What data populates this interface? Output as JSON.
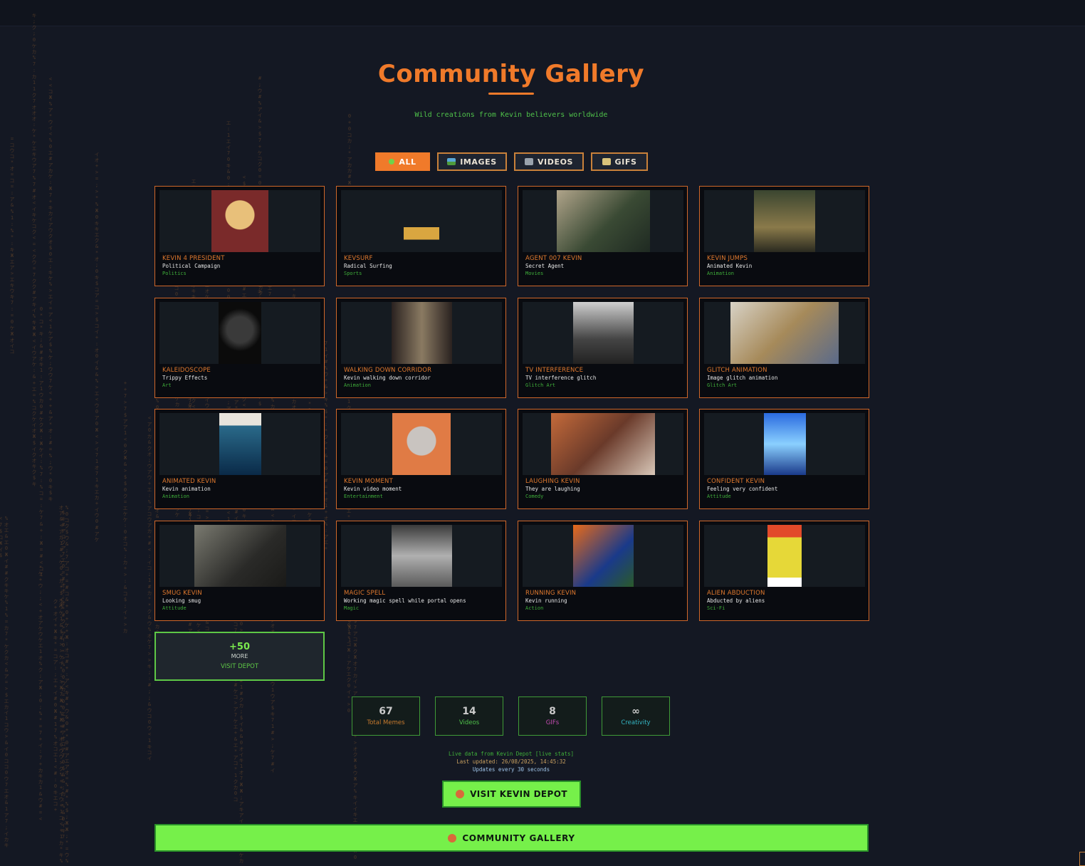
{
  "header": {
    "title": "Community Gallery",
    "subtitle": "Wild creations from Kevin believers worldwide"
  },
  "filters": [
    {
      "label": "ALL",
      "icon": "sparkle-icon",
      "active": true
    },
    {
      "label": "IMAGES",
      "icon": "image-icon",
      "active": false
    },
    {
      "label": "VIDEOS",
      "icon": "film-icon",
      "active": false
    },
    {
      "label": "GIFS",
      "icon": "gif-icon",
      "active": false
    }
  ],
  "gallery": [
    {
      "title": "KEVIN 4 PRESIDENT",
      "desc": "Political Campaign",
      "category": "Politics"
    },
    {
      "title": "KEVSURF",
      "desc": "Radical Surfing",
      "category": "Sports"
    },
    {
      "title": "AGENT 007 KEVIN",
      "desc": "Secret Agent",
      "category": "Movies"
    },
    {
      "title": "KEVIN JUMPS",
      "desc": "Animated Kevin",
      "category": "Animation"
    },
    {
      "title": "KALEIDOSCOPE",
      "desc": "Trippy Effects",
      "category": "Art"
    },
    {
      "title": "WALKING DOWN CORRIDOR",
      "desc": "Kevin walking down corridor",
      "category": "Animation"
    },
    {
      "title": "TV INTERFERENCE",
      "desc": "TV interference glitch",
      "category": "Glitch Art"
    },
    {
      "title": "GLITCH ANIMATION",
      "desc": "Image glitch animation",
      "category": "Glitch Art"
    },
    {
      "title": "ANIMATED KEVIN",
      "desc": "Kevin animation",
      "category": "Animation"
    },
    {
      "title": "KEVIN MOMENT",
      "desc": "Kevin video moment",
      "category": "Entertainment"
    },
    {
      "title": "LAUGHING KEVIN",
      "desc": "They are laughing",
      "category": "Comedy"
    },
    {
      "title": "CONFIDENT KEVIN",
      "desc": "Feeling very confident",
      "category": "Attitude"
    },
    {
      "title": "SMUG KEVIN",
      "desc": "Looking smug",
      "category": "Attitude"
    },
    {
      "title": "MAGIC SPELL",
      "desc": "Working magic spell while portal opens",
      "category": "Magic"
    },
    {
      "title": "RUNNING KEVIN",
      "desc": "Kevin running",
      "category": "Action"
    },
    {
      "title": "ALIEN ABDUCTION",
      "desc": "Abducted by aliens",
      "category": "Sci-Fi"
    }
  ],
  "more": {
    "count": "+50",
    "label": "MORE",
    "link": "VISIT DEPOT"
  },
  "stats": [
    {
      "value": "67",
      "label": "Total Memes",
      "color": "#c77a2e"
    },
    {
      "value": "14",
      "label": "Videos",
      "color": "#4fc24a"
    },
    {
      "value": "8",
      "label": "GIFs",
      "color": "#c24ab0"
    },
    {
      "value": "∞",
      "label": "Creativity",
      "color": "#34b6c4"
    }
  ],
  "info": {
    "line1": "Live data from Kevin Depot [live stats]",
    "line2": "Last updated: 26/08/2025, 14:45:32",
    "line3": "Updates every 30 seconds"
  },
  "visit_button": {
    "label": "VISIT KEVIN DEPOT"
  },
  "community_bar": {
    "label": "COMMUNITY GALLERY"
  },
  "colors": {
    "accent": "#f07a2a",
    "green": "#76f04a",
    "background": "#141823"
  }
}
